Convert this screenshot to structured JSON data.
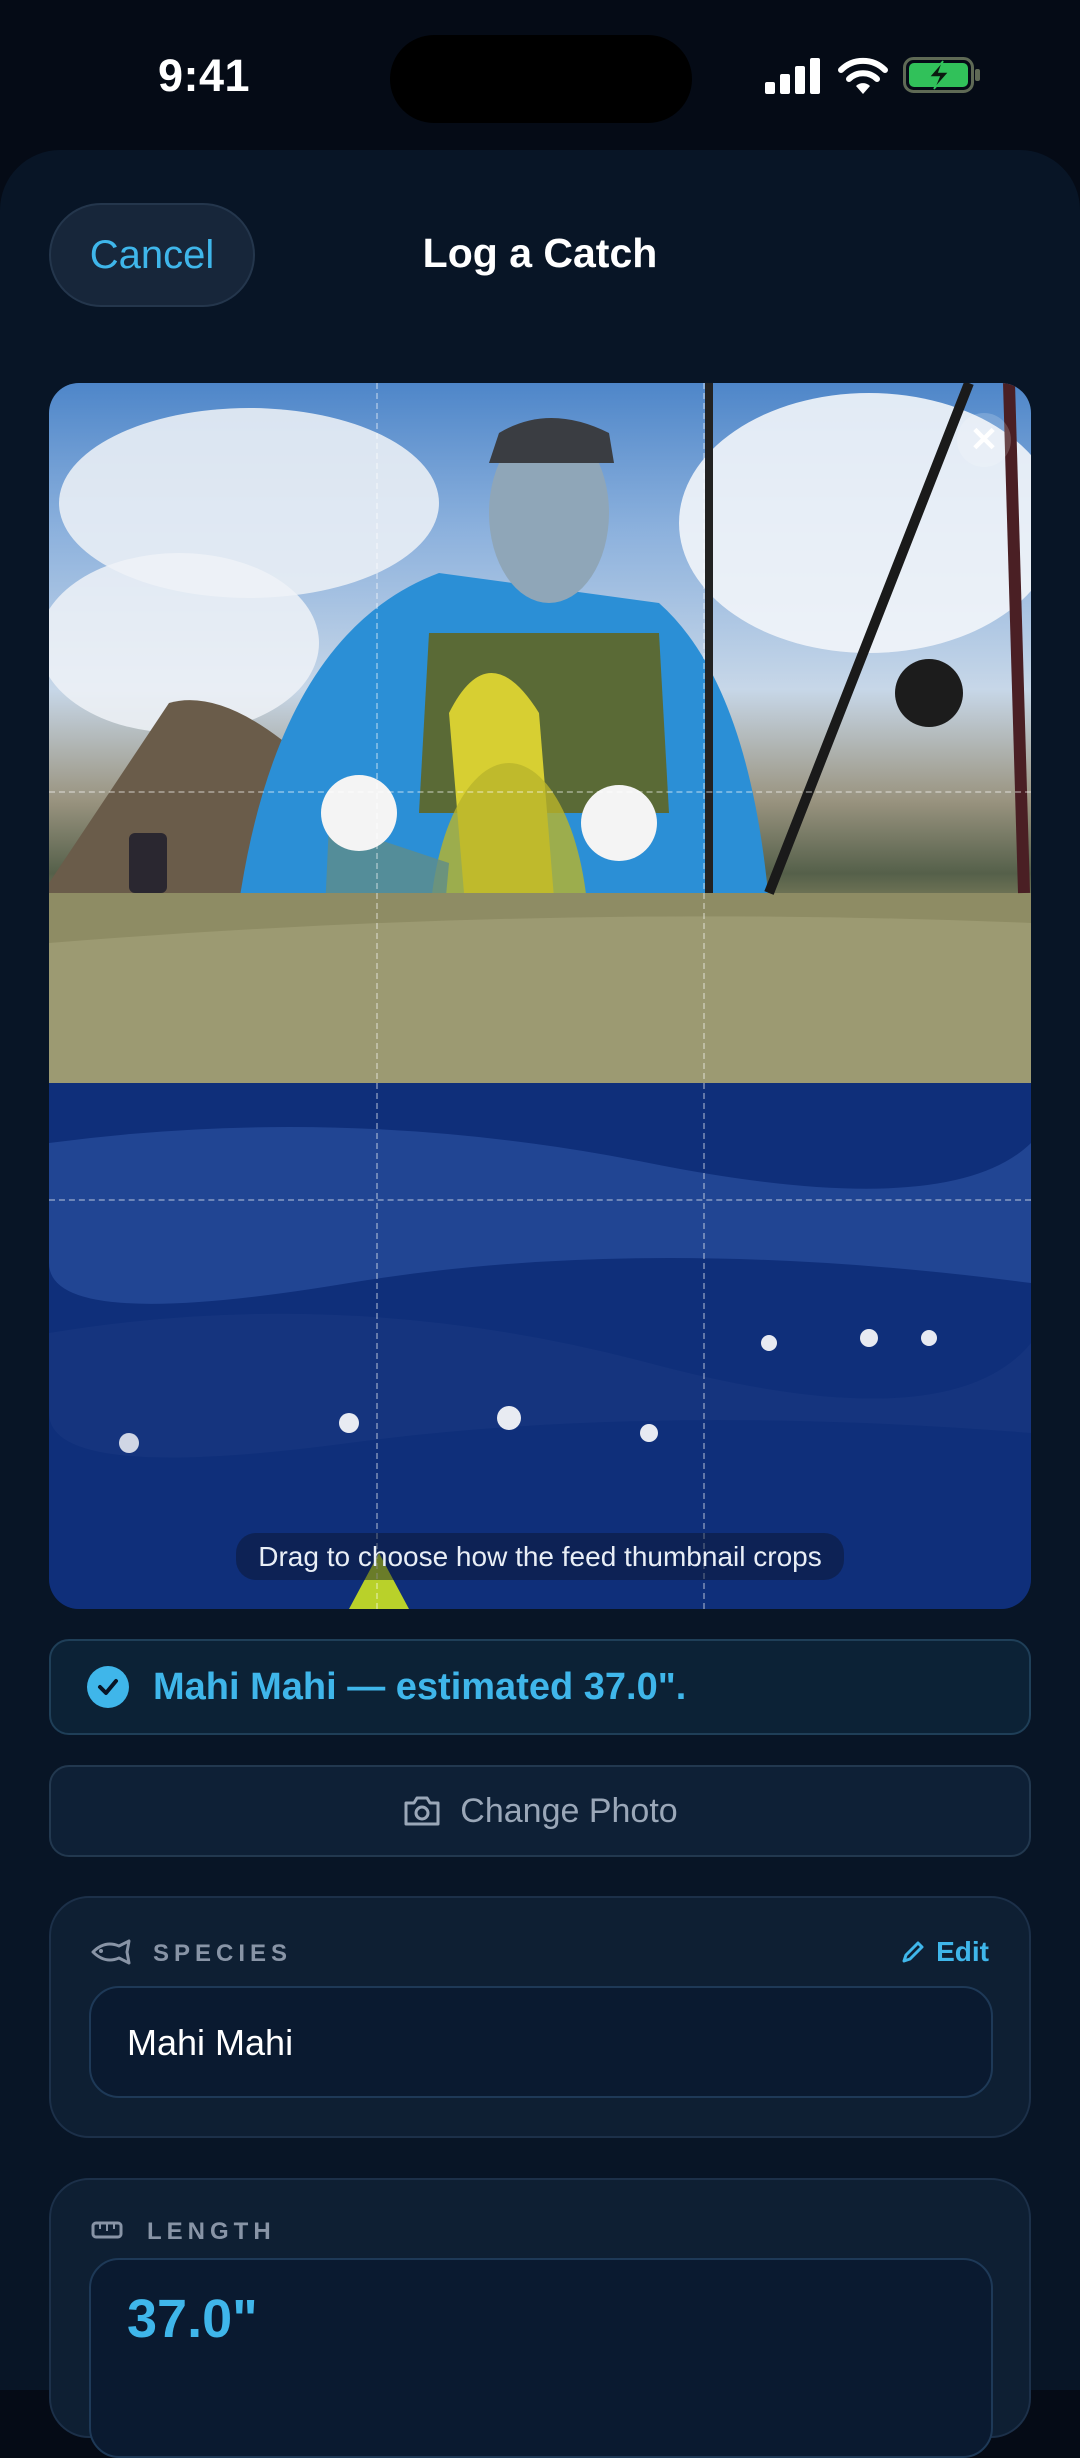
{
  "status_bar": {
    "time": "9:41"
  },
  "header": {
    "cancel_label": "Cancel",
    "title": "Log a Catch"
  },
  "photo": {
    "crop_hint": "Drag to choose how the feed thumbnail crops",
    "close_icon": "close-icon"
  },
  "ai_result": {
    "text": "Mahi Mahi — estimated 37.0\".",
    "icon": "checkmark-circle-icon"
  },
  "change_photo": {
    "label": "Change Photo",
    "icon": "camera-icon"
  },
  "species": {
    "label": "SPECIES",
    "edit_label": "Edit",
    "value": "Mahi Mahi",
    "icon": "fish-icon"
  },
  "length": {
    "label": "LENGTH",
    "value": "37.0\"",
    "icon": "ruler-icon"
  },
  "colors": {
    "accent": "#3fb6ea",
    "background": "#050b16",
    "card": "#0e1f33"
  }
}
